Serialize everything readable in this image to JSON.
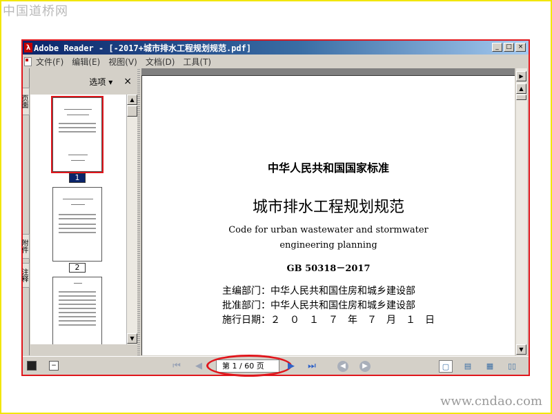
{
  "watermark": {
    "top": "中国道桥网",
    "bottom": "www.cndao.com"
  },
  "window": {
    "title": "Adobe Reader - [-2017+城市排水工程规划规范.pdf]",
    "controls": {
      "minimize": "_",
      "restore": "□",
      "close": "×"
    }
  },
  "menu": [
    {
      "label": "文件(F)"
    },
    {
      "label": "编辑(E)"
    },
    {
      "label": "视图(V)"
    },
    {
      "label": "文档(D)"
    },
    {
      "label": "工具(T)"
    }
  ],
  "side_tabs": {
    "pages": "页面",
    "attachments": "附件",
    "comments": "注释"
  },
  "panel": {
    "options_label": "选项 ▾",
    "close": "×"
  },
  "thumbnails": [
    {
      "label": "1",
      "selected": true
    },
    {
      "label": "2",
      "selected": false
    }
  ],
  "document": {
    "standard_title": "中华人民共和国国家标准",
    "cn_title": "城市排水工程规划规范",
    "en_title_line1": "Code for urban wastewater and stormwater",
    "en_title_line2": "engineering planning",
    "code": "GB 50318－2017",
    "lines": [
      "主编部门：中华人民共和国住房和城乡建设部",
      "批准部门：中华人民共和国住房和城乡建设部",
      "施行日期：２　０　１　７　年　７　月　１　日"
    ]
  },
  "statusbar": {
    "page_display": "第 1 / 60 页",
    "nav": {
      "first": "⏮",
      "prev": "◀",
      "next": "▶",
      "last": "⏭"
    },
    "history": {
      "back": "◀",
      "forward": "▶"
    },
    "views": [
      "single-page",
      "continuous",
      "facing-continuous",
      "facing"
    ]
  },
  "colors": {
    "highlight_ring": "#e0151b",
    "titlebar": "#0a246a",
    "chrome": "#d4d0c8"
  }
}
